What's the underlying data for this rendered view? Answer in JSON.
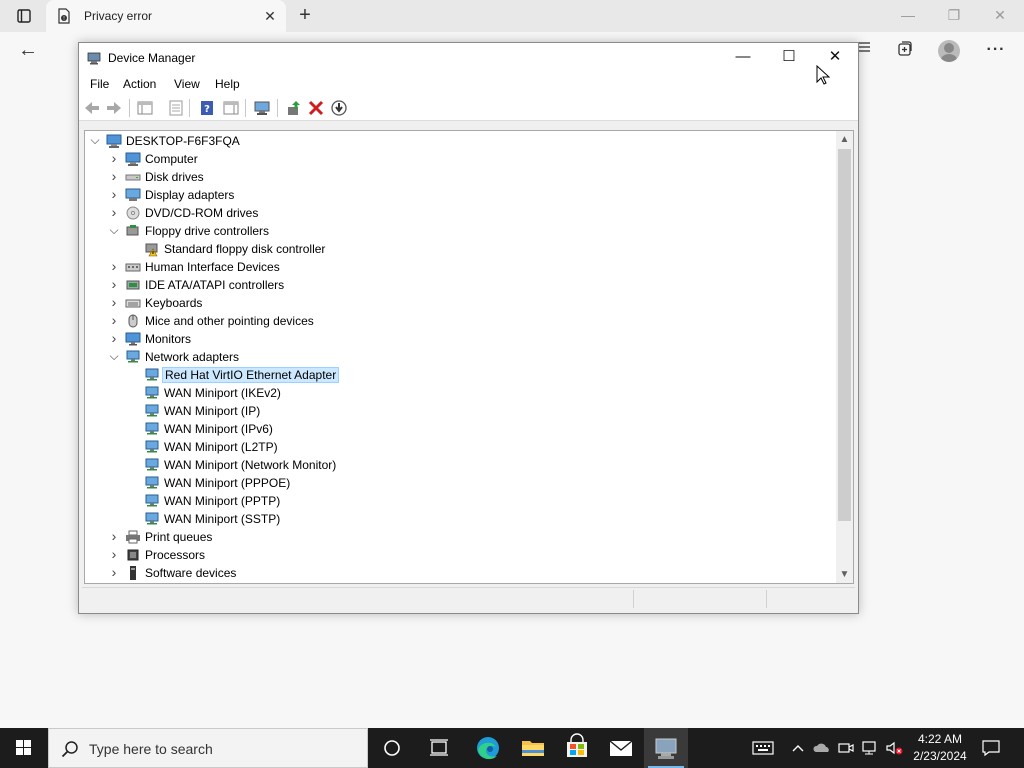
{
  "browser": {
    "tab_title": "Privacy error",
    "tab_close_glyph": "✕",
    "new_tab_glyph": "+",
    "back_glyph": "←",
    "win_minimize": "—",
    "win_restore": "❐",
    "win_close": "✕",
    "toolbar_icons": [
      "favorites-icon",
      "collections-icon",
      "profile-avatar",
      "more-icon"
    ],
    "more_glyph": "···"
  },
  "device_manager": {
    "title": "Device Manager",
    "controls": {
      "minimize": "—",
      "maximize": "☐",
      "close": "✕"
    },
    "menu": [
      "File",
      "Action",
      "View",
      "Help"
    ],
    "toolbar_icons": [
      "back-icon",
      "forward-icon",
      "show-hide-console-tree-icon",
      "properties-icon",
      "help-icon",
      "show-action-pane-icon",
      "scan-hardware-icon",
      "update-driver-icon",
      "uninstall-icon",
      "disable-device-icon"
    ],
    "tree": {
      "root": "DESKTOP-F6F3FQA",
      "items": [
        {
          "label": "Computer",
          "level": 1,
          "expanded": false,
          "icon": "computer-icon"
        },
        {
          "label": "Disk drives",
          "level": 1,
          "expanded": false,
          "icon": "disk-drive-icon"
        },
        {
          "label": "Display adapters",
          "level": 1,
          "expanded": false,
          "icon": "display-adapter-icon"
        },
        {
          "label": "DVD/CD-ROM drives",
          "level": 1,
          "expanded": false,
          "icon": "dvd-drive-icon"
        },
        {
          "label": "Floppy drive controllers",
          "level": 1,
          "expanded": true,
          "icon": "floppy-controller-icon"
        },
        {
          "label": "Standard floppy disk controller",
          "level": 2,
          "icon": "floppy-warning-icon"
        },
        {
          "label": "Human Interface Devices",
          "level": 1,
          "expanded": false,
          "icon": "hid-icon"
        },
        {
          "label": "IDE ATA/ATAPI controllers",
          "level": 1,
          "expanded": false,
          "icon": "ide-controller-icon"
        },
        {
          "label": "Keyboards",
          "level": 1,
          "expanded": false,
          "icon": "keyboard-icon"
        },
        {
          "label": "Mice and other pointing devices",
          "level": 1,
          "expanded": false,
          "icon": "mouse-icon"
        },
        {
          "label": "Monitors",
          "level": 1,
          "expanded": false,
          "icon": "monitor-icon"
        },
        {
          "label": "Network adapters",
          "level": 1,
          "expanded": true,
          "icon": "network-adapter-icon"
        },
        {
          "label": "Red Hat VirtIO Ethernet Adapter",
          "level": 2,
          "icon": "network-adapter-icon",
          "selected": true
        },
        {
          "label": "WAN Miniport (IKEv2)",
          "level": 2,
          "icon": "network-adapter-icon"
        },
        {
          "label": "WAN Miniport (IP)",
          "level": 2,
          "icon": "network-adapter-icon"
        },
        {
          "label": "WAN Miniport (IPv6)",
          "level": 2,
          "icon": "network-adapter-icon"
        },
        {
          "label": "WAN Miniport (L2TP)",
          "level": 2,
          "icon": "network-adapter-icon"
        },
        {
          "label": "WAN Miniport (Network Monitor)",
          "level": 2,
          "icon": "network-adapter-icon"
        },
        {
          "label": "WAN Miniport (PPPOE)",
          "level": 2,
          "icon": "network-adapter-icon"
        },
        {
          "label": "WAN Miniport (PPTP)",
          "level": 2,
          "icon": "network-adapter-icon"
        },
        {
          "label": "WAN Miniport (SSTP)",
          "level": 2,
          "icon": "network-adapter-icon"
        },
        {
          "label": "Print queues",
          "level": 1,
          "expanded": false,
          "icon": "printer-icon"
        },
        {
          "label": "Processors",
          "level": 1,
          "expanded": false,
          "icon": "processor-icon"
        },
        {
          "label": "Software devices",
          "level": 1,
          "expanded": false,
          "icon": "software-device-icon"
        }
      ]
    }
  },
  "taskbar": {
    "search_placeholder": "Type here to search",
    "clock_time": "4:22 AM",
    "clock_date": "2/23/2024",
    "apps": [
      "cortana-icon",
      "task-view-icon",
      "edge-icon",
      "file-explorer-icon",
      "store-icon",
      "mail-icon",
      "device-manager-icon"
    ],
    "tray": [
      "keyboard-layout-icon",
      "show-hidden-icons-icon",
      "onedrive-icon",
      "meet-now-icon",
      "network-icon",
      "volume-muted-icon"
    ]
  },
  "colors": {
    "taskbar_bg": "#1c1c1c",
    "selection_bg": "#cce8ff",
    "accent": "#0078d7"
  }
}
